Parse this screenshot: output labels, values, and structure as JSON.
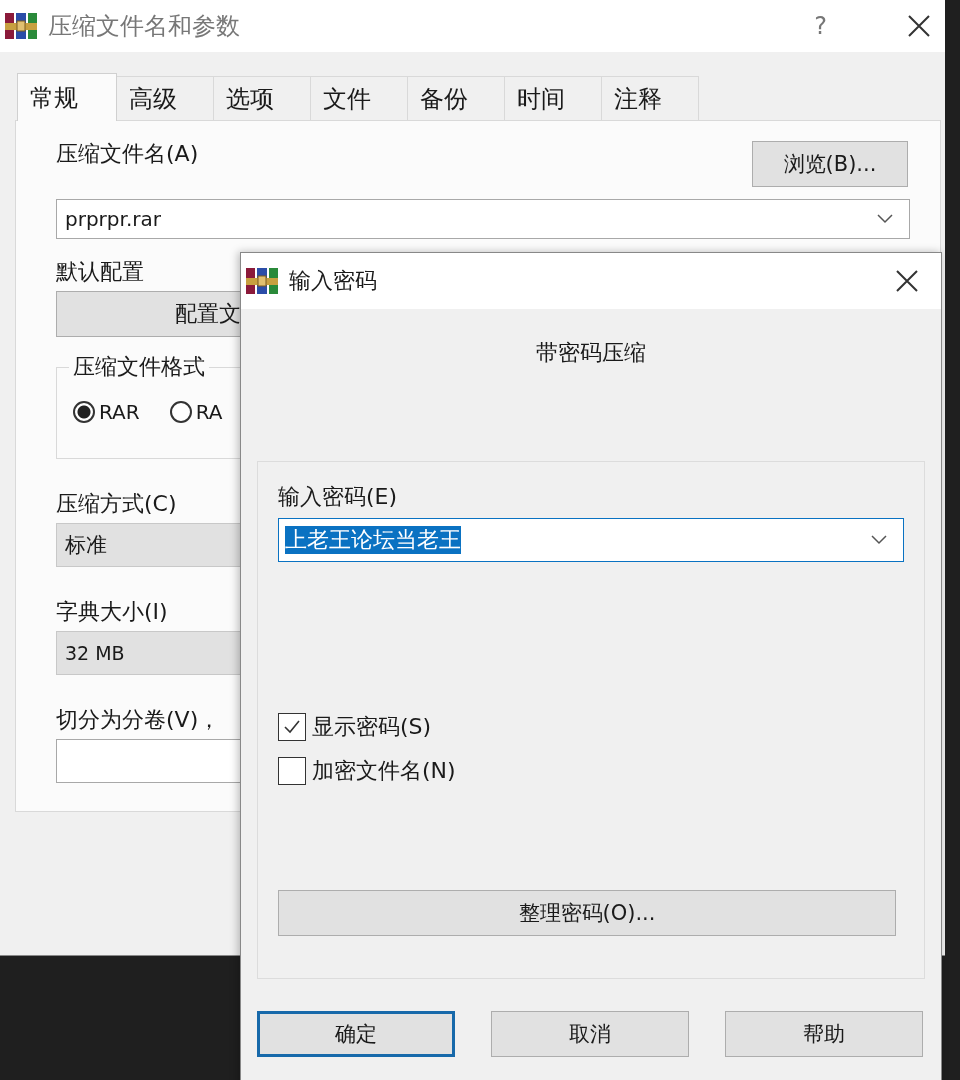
{
  "window": {
    "title": "压缩文件名和参数",
    "help": "?"
  },
  "tabs": [
    {
      "label": "常规",
      "selected": true
    },
    {
      "label": "高级",
      "selected": false
    },
    {
      "label": "选项",
      "selected": false
    },
    {
      "label": "文件",
      "selected": false
    },
    {
      "label": "备份",
      "selected": false
    },
    {
      "label": "时间",
      "selected": false
    },
    {
      "label": "注释",
      "selected": false
    }
  ],
  "general": {
    "archive_name_label": "压缩文件名(A)",
    "browse_button": "浏览(B)...",
    "archive_name": "prprpr.rar",
    "profile_label": "默认配置",
    "profile_button": "配置文",
    "format_group": "压缩文件格式",
    "formats": [
      {
        "label": "RAR",
        "selected": true
      },
      {
        "label": "RA",
        "selected": false
      }
    ],
    "method_label": "压缩方式(C)",
    "method": "标准",
    "dictionary_label": "字典大小(I)",
    "dictionary": "32 MB",
    "split_label": "切分为分卷(V)，"
  },
  "password_dialog": {
    "title": "输入密码",
    "heading": "带密码压缩",
    "password_label": "输入密码(E)",
    "password": "上老王论坛当老王",
    "options": [
      {
        "label": "显示密码(S)",
        "checked": true
      },
      {
        "label": "加密文件名(N)",
        "checked": false
      }
    ],
    "organize_button": "整理密码(O)...",
    "buttons": [
      {
        "label": "确定",
        "default": true
      },
      {
        "label": "取消",
        "default": false
      },
      {
        "label": "帮助",
        "default": false
      }
    ]
  }
}
